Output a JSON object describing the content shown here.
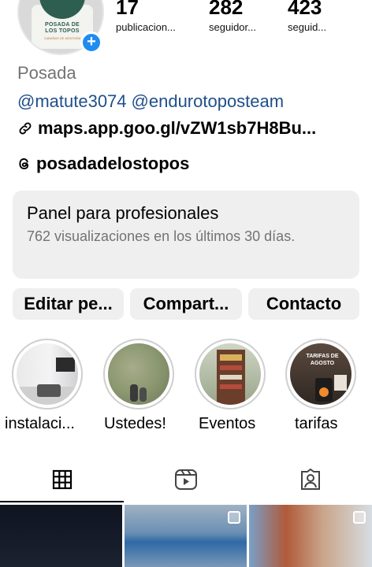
{
  "profile": {
    "avatar_logo_line1": "POSADA DE",
    "avatar_logo_line2": "LOS TOPOS",
    "avatar_logo_tagline": "CABAÑAS DE MONTAÑA",
    "add_badge": "+"
  },
  "stats": [
    {
      "value": "17",
      "label": "publicacion..."
    },
    {
      "value": "282",
      "label": "seguidor..."
    },
    {
      "value": "423",
      "label": "seguid..."
    }
  ],
  "bio": {
    "name": "Posada",
    "mention_1": "@matute3074",
    "mention_2": "@endurotoposteam",
    "link": "maps.app.goo.gl/vZW1sb7H8Bu...",
    "threads": "posadadelostopos"
  },
  "dashboard": {
    "title": "Panel para profesionales",
    "subtitle": "762 visualizaciones en los últimos 30 días."
  },
  "buttons": {
    "edit": "Editar pe...",
    "share": "Compart...",
    "contact": "Contacto"
  },
  "highlights": [
    {
      "label": "instalaci..."
    },
    {
      "label": "Ustedes!"
    },
    {
      "label": "Eventos"
    },
    {
      "label": "tarifas",
      "cover_text": "TARIFAS DE AGOSTO"
    }
  ],
  "tabs": [
    {
      "icon": "grid-icon",
      "active": true
    },
    {
      "icon": "reels-icon",
      "active": false
    },
    {
      "icon": "tagged-icon",
      "active": false
    }
  ],
  "colors": {
    "link_blue": "#1f4f8a",
    "badge_blue": "#1f8cf0",
    "muted_gray": "#737373",
    "panel_bg": "#efefef"
  }
}
